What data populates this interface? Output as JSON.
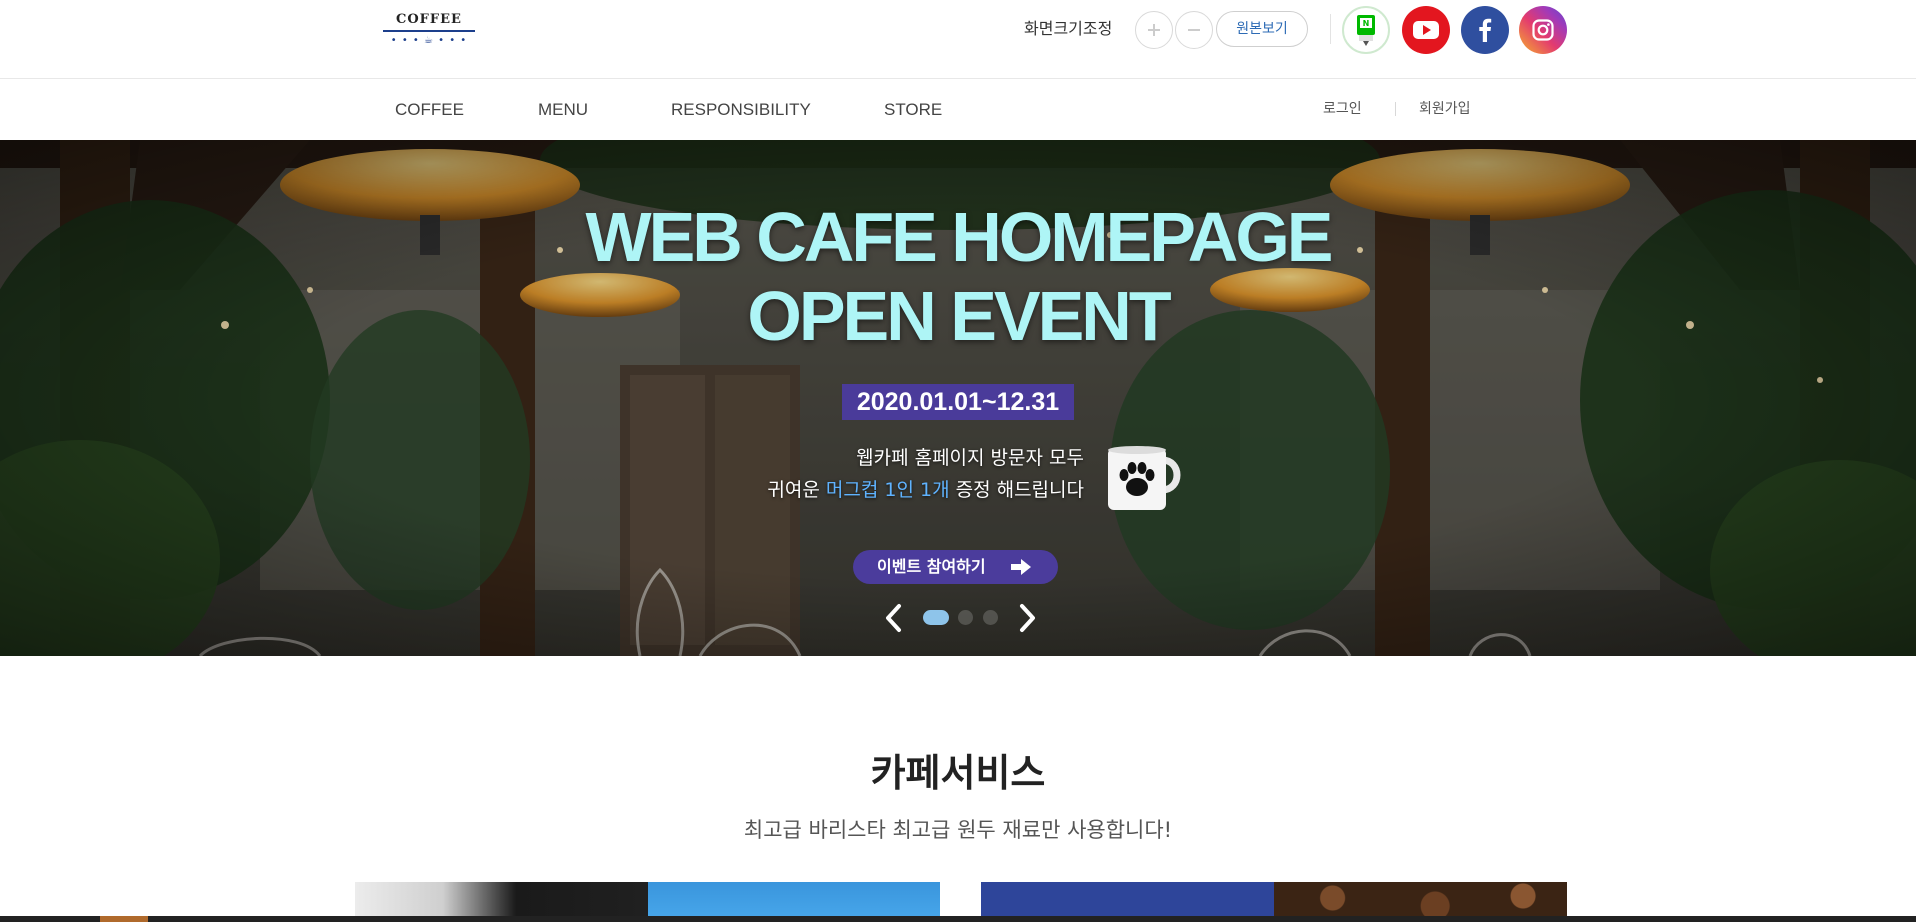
{
  "header": {
    "logo": {
      "text": "COFFEE"
    },
    "zoom": {
      "label": "화면크기조정",
      "zoom_in_icon": "plus-icon",
      "zoom_out_icon": "minus-icon",
      "original_label": "원본보기"
    },
    "social": [
      {
        "name": "line",
        "icon": "line-icon",
        "color": "#00b900"
      },
      {
        "name": "youtube",
        "icon": "youtube-icon",
        "color": "#e3161f"
      },
      {
        "name": "facebook",
        "icon": "facebook-icon",
        "color": "#2f4f9f"
      },
      {
        "name": "instagram",
        "icon": "instagram-icon",
        "color": "#c13584"
      }
    ]
  },
  "nav": {
    "items": [
      {
        "label": "COFFEE"
      },
      {
        "label": "MENU"
      },
      {
        "label": "RESPONSIBILITY"
      },
      {
        "label": "STORE"
      }
    ],
    "login": "로그인",
    "join": "회원가입"
  },
  "hero": {
    "title_line1": "WEB CAFE HOMEPAGE",
    "title_line2": "OPEN EVENT",
    "date": "2020.01.01~12.31",
    "desc_line1": "웹카페 홈페이지 방문자 모두",
    "desc_line2_pre": "귀여운 ",
    "desc_line2_highlight": "머그컵 1인 1개",
    "desc_line2_post": " 증정 해드립니다",
    "cta": "이벤트 참여하기",
    "slide_current": 1,
    "slide_total": 3,
    "colors": {
      "title": "#aef5f6",
      "date_bg": "#4a3b9a",
      "highlight": "#5fb3ff"
    }
  },
  "service": {
    "title": "카페서비스",
    "subtitle": "최고급 바리스타 최고급 원두 재료만 사용합니다!"
  }
}
